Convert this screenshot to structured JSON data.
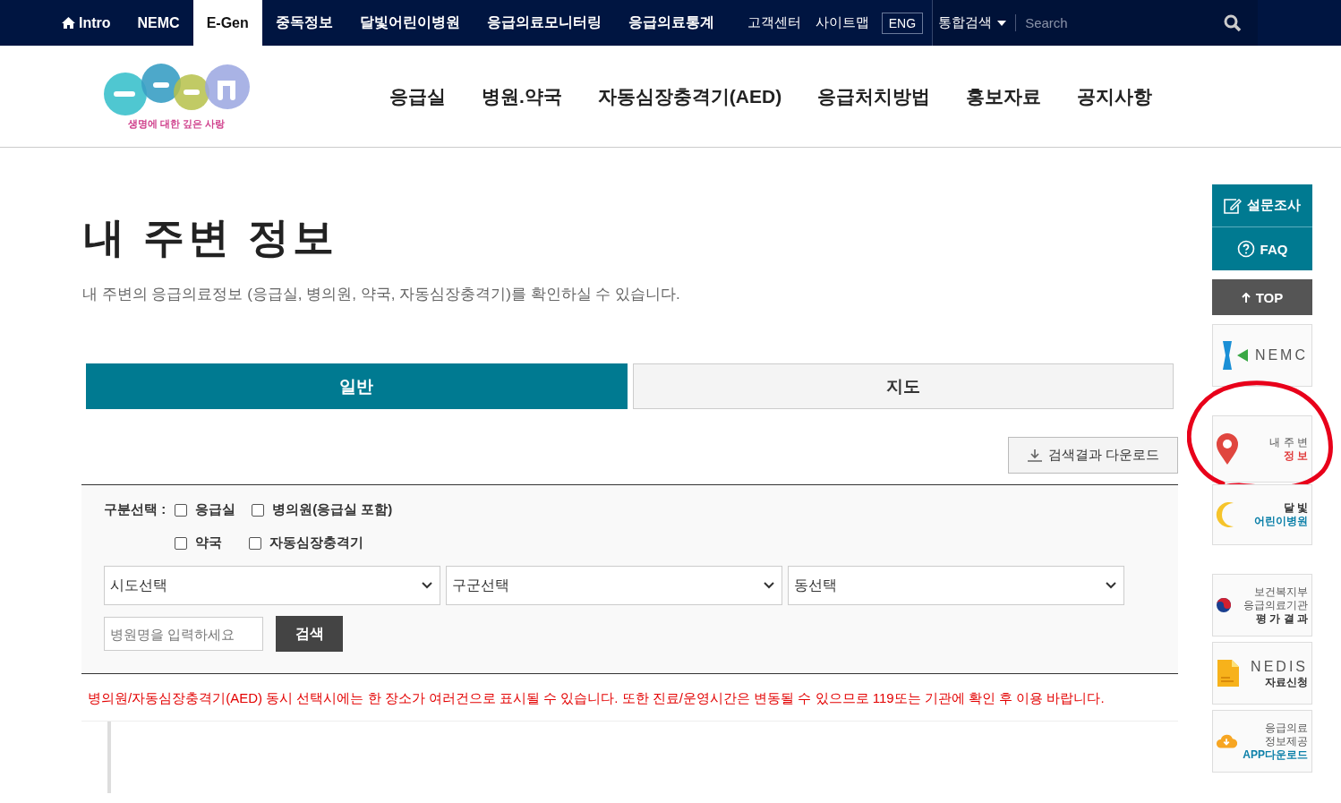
{
  "top_bar": {
    "links": [
      {
        "label": "Intro",
        "kind": "home",
        "selected": false
      },
      {
        "label": "NEMC",
        "kind": "plain",
        "selected": false
      },
      {
        "label": "E-Gen",
        "kind": "plain",
        "selected": true
      },
      {
        "label": "중독정보",
        "kind": "plain",
        "selected": false
      },
      {
        "label": "달빛어린이병원",
        "kind": "plain",
        "selected": false
      },
      {
        "label": "응급의료모니터링",
        "kind": "plain",
        "selected": false
      },
      {
        "label": "응급의료통계",
        "kind": "plain",
        "selected": false
      }
    ],
    "utility_links": [
      "고객센터",
      "사이트맵"
    ],
    "language_button": "ENG",
    "search_scope": "통합검색",
    "search": {
      "placeholder": "Search"
    }
  },
  "logo": {
    "tagline": "생명에 대한 깊은 사랑"
  },
  "main_nav": [
    "응급실",
    "병원.약국",
    "자동심장충격기(AED)",
    "응급처치방법",
    "홍보자료",
    "공지사항"
  ],
  "page": {
    "title": "내 주변 정보",
    "subtitle": "내 주변의 응급의료정보 (응급실, 병의원, 약국, 자동심장충격기)를 확인하실 수 있습니다."
  },
  "tabs": [
    {
      "label": "일반",
      "selected": true
    },
    {
      "label": "지도",
      "selected": false
    }
  ],
  "download_button": "검색결과 다운로드",
  "filter": {
    "label": "구분선택 :",
    "options": [
      {
        "label": "응급실",
        "checked": false
      },
      {
        "label": "병의원(응급실 포함)",
        "checked": false
      },
      {
        "label": "약국",
        "checked": false
      },
      {
        "label": "자동심장충격기",
        "checked": false
      }
    ],
    "selects": [
      "시도선택",
      "구군선택",
      "동선택"
    ],
    "name_field": {
      "placeholder": "병원명을 입력하세요"
    },
    "search_button": "검색"
  },
  "notice": "병의원/자동심장충격기(AED) 동시 선택시에는 한 장소가 여러건으로 표시될 수 있습니다. 또한 진료/운영시간은 변동될 수 있으므로 119또는 기관에 확인 후 이용 바랍니다.",
  "quick_menu": {
    "buttons": [
      {
        "label": "설문조사",
        "kind": "survey"
      },
      {
        "label": "FAQ",
        "kind": "faq"
      },
      {
        "label": "TOP",
        "kind": "top"
      }
    ],
    "tiles": [
      {
        "kind": "nemc",
        "highlighted": false,
        "lines": [
          "NEMC"
        ]
      },
      {
        "kind": "location",
        "highlighted": true,
        "lines": [
          "내 주 변",
          "정 보"
        ]
      },
      {
        "kind": "moon",
        "highlighted": false,
        "lines": [
          "달 빛",
          "어린이병원"
        ]
      },
      {
        "kind": "mohw",
        "highlighted": false,
        "lines": [
          "보건복지부",
          "응급의료기관",
          "평 가 결 과"
        ]
      },
      {
        "kind": "nedis",
        "highlighted": false,
        "lines": [
          "NEDIS",
          "자료신청"
        ]
      },
      {
        "kind": "app",
        "highlighted": false,
        "lines": [
          "응급의료",
          "정보제공",
          "APP다운로드"
        ]
      }
    ]
  }
}
